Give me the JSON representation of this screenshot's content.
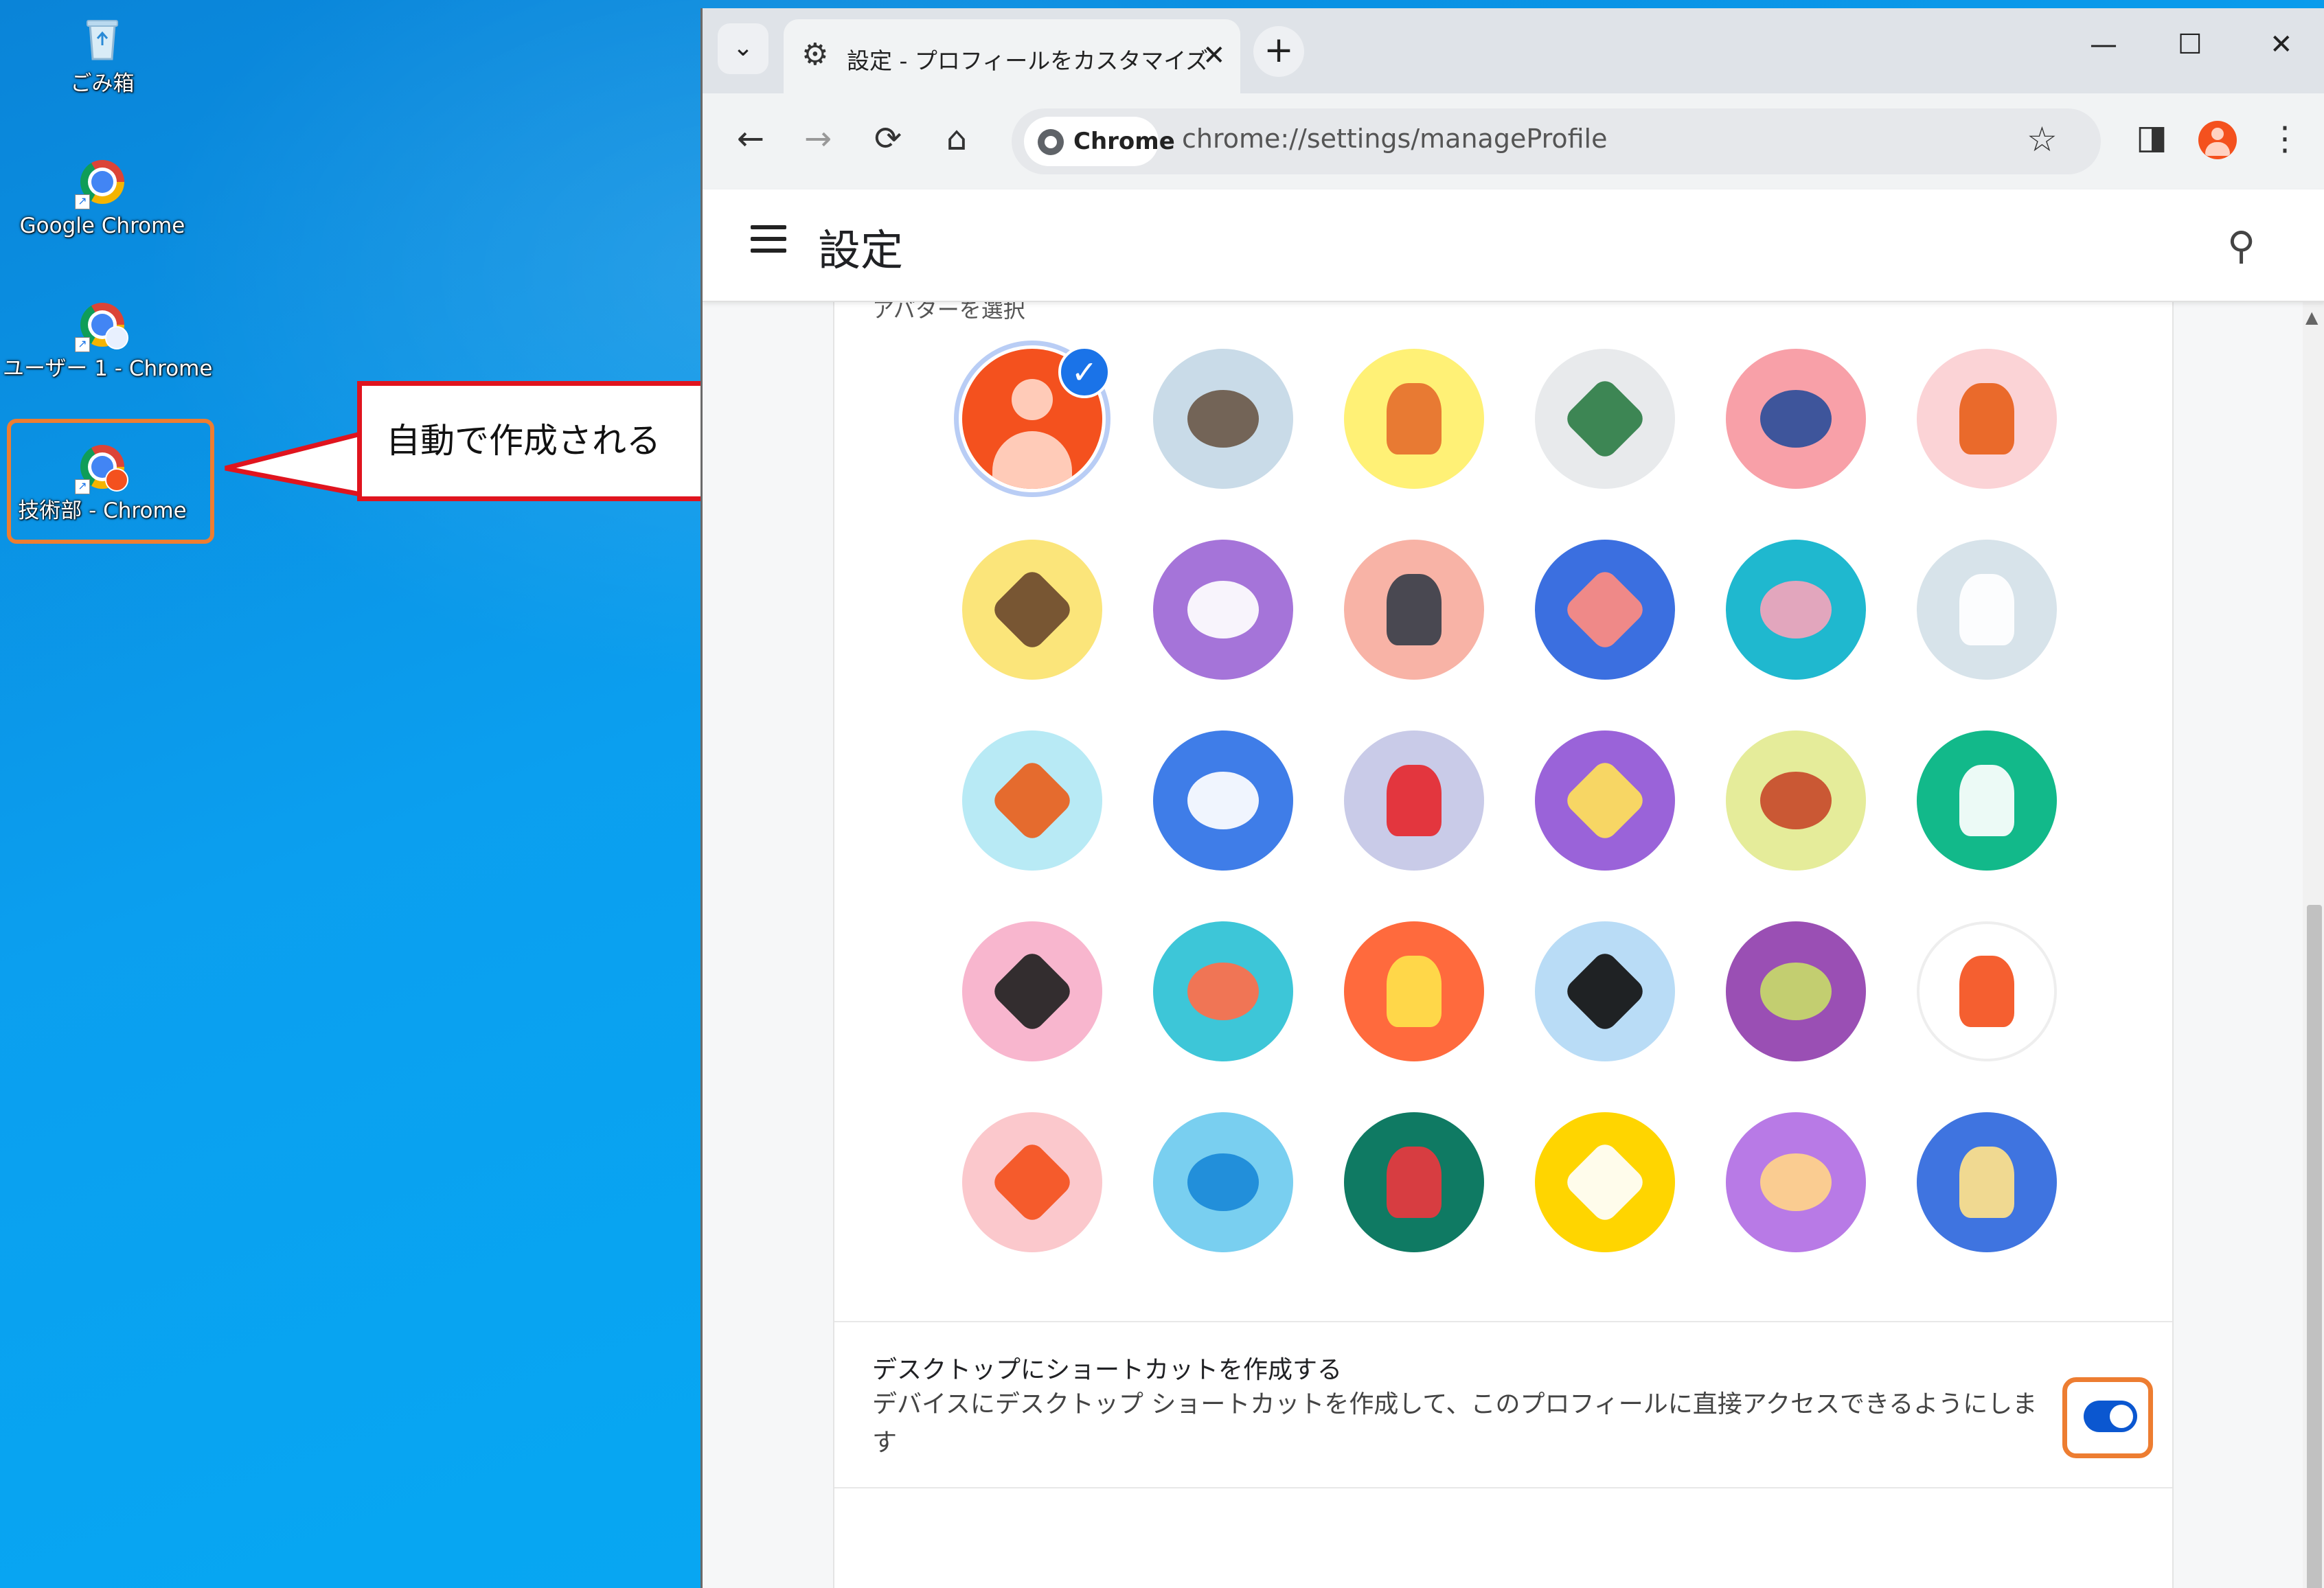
{
  "desktop": {
    "icons": [
      {
        "label": "ごみ箱",
        "icon": "recycle-bin-icon"
      },
      {
        "label": "Google Chrome",
        "icon": "chrome-icon"
      },
      {
        "label": "ユーザー 1 - Chrome",
        "icon": "chrome-profile-icon"
      },
      {
        "label": "技術部 - Chrome",
        "icon": "chrome-profile-icon"
      }
    ],
    "callout_text": "自動で作成される",
    "highlight_color": "#ed7d31",
    "callout_color": "#e0141e"
  },
  "browser": {
    "tab_title": "設定 - プロフィールをカスタマイズ",
    "tab_close": "✕",
    "new_tab": "+",
    "tab_search": "⌄",
    "window_controls": {
      "minimize": "—",
      "maximize": "☐",
      "close": "✕"
    },
    "nav": {
      "back": "←",
      "forward": "→",
      "reload": "⟳",
      "home": "⌂"
    },
    "chip_label": "Chrome",
    "url": "chrome://settings/manageProfile",
    "star": "☆",
    "menu": "⋮",
    "side_panel": "◨"
  },
  "settings": {
    "title": "設定",
    "section_heading_partial": "アバターを選択",
    "shortcut_title": "デスクトップにショートカットを作成する",
    "shortcut_desc": "デバイスにデスクトップ ショートカットを作成して、このプロフィールに直接アクセスできるようにします",
    "shortcut_enabled": true,
    "accent": "#1a73e8",
    "avatars": [
      {
        "name": "person",
        "bg": "#f4511e",
        "fg": "#ffcbb8",
        "selected": true
      },
      {
        "name": "cat",
        "bg": "#c9dbe8",
        "fg": "#6b5a4a"
      },
      {
        "name": "corgi",
        "bg": "#fff176",
        "fg": "#e6702e"
      },
      {
        "name": "dragon",
        "bg": "#e8eaec",
        "fg": "#2e7d46"
      },
      {
        "name": "elephant",
        "bg": "#f8a0a8",
        "fg": "#2e4e9a"
      },
      {
        "name": "fox",
        "bg": "#fbd3d6",
        "fg": "#e8611c"
      },
      {
        "name": "monkey",
        "bg": "#fbe57a",
        "fg": "#6d4a2c"
      },
      {
        "name": "panda",
        "bg": "#a574d9",
        "fg": "#ffffff"
      },
      {
        "name": "penguin",
        "bg": "#f8b3a6",
        "fg": "#3a3f4a"
      },
      {
        "name": "butterfly",
        "bg": "#3b6fe0",
        "fg": "#ff8b80"
      },
      {
        "name": "rabbit",
        "bg": "#1fb8cf",
        "fg": "#f3a4bc"
      },
      {
        "name": "unicorn",
        "bg": "#d7e3ea",
        "fg": "#ffffff"
      },
      {
        "name": "basketball",
        "bg": "#b8eaf5",
        "fg": "#e8601c"
      },
      {
        "name": "bike",
        "bg": "#3f7de8",
        "fg": "#ffffff"
      },
      {
        "name": "bird",
        "bg": "#c9cbe8",
        "fg": "#e5292f"
      },
      {
        "name": "cheese",
        "bg": "#9a63d9",
        "fg": "#ffe05a"
      },
      {
        "name": "football",
        "bg": "#e5ec9a",
        "fg": "#c84b2b"
      },
      {
        "name": "ramen",
        "bg": "#12b98a",
        "fg": "#ffffff"
      },
      {
        "name": "sunglasses",
        "bg": "#f8b6ce",
        "fg": "#222222"
      },
      {
        "name": "sushi",
        "bg": "#3dc6d8",
        "fg": "#ff6e4a"
      },
      {
        "name": "tamagotchi",
        "bg": "#ff6a3d",
        "fg": "#ffe14a"
      },
      {
        "name": "vinyl",
        "bg": "#b9dcf6",
        "fg": "#111111"
      },
      {
        "name": "avocado",
        "bg": "#9a4fb4",
        "fg": "#c7d96a"
      },
      {
        "name": "smile",
        "bg": "#ffffff",
        "fg": "#f4511e"
      },
      {
        "name": "icecream",
        "bg": "#fbc8cc",
        "fg": "#f4511e"
      },
      {
        "name": "ice-cube",
        "bg": "#79cff0",
        "fg": "#1b8ad8"
      },
      {
        "name": "watermelon",
        "bg": "#0f7a63",
        "fg": "#e8373e"
      },
      {
        "name": "onigiri",
        "bg": "#ffd500",
        "fg": "#ffffff"
      },
      {
        "name": "pizza",
        "bg": "#b87ae6",
        "fg": "#ffd38a"
      },
      {
        "name": "sandwich",
        "bg": "#3f74e0",
        "fg": "#ffe28a"
      }
    ]
  }
}
